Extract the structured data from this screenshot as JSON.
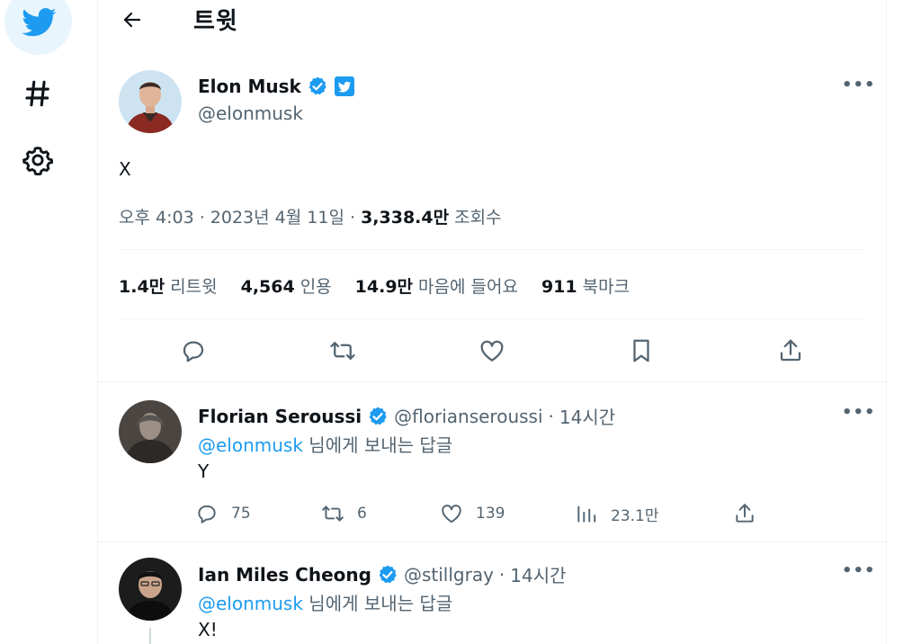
{
  "nav": {
    "logo_icon": "twitter-bird-icon",
    "items": [
      {
        "icon": "hashtag-icon"
      },
      {
        "icon": "gear-icon"
      }
    ]
  },
  "header": {
    "back_icon": "arrow-left-icon",
    "title": "트윗"
  },
  "tweet": {
    "author_name": "Elon Musk",
    "author_handle": "@elonmusk",
    "text": "X",
    "time": "오후 4:03",
    "date": "2023년 4월 11일",
    "views": "3,338.4만",
    "views_label": "조회수",
    "sep": " · ",
    "stats": [
      {
        "value": "1.4만",
        "label": "리트윗"
      },
      {
        "value": "4,564",
        "label": "인용"
      },
      {
        "value": "14.9만",
        "label": "마음에 들어요"
      },
      {
        "value": "911",
        "label": "북마크"
      }
    ],
    "more": "•••"
  },
  "replies": [
    {
      "name": "Florian Seroussi",
      "handle": "@florianseroussi",
      "time": "14시간",
      "mention": "@elonmusk",
      "reply_suffix": " 님에게 보내는 답글",
      "text": "Y",
      "replies": "75",
      "retweets": "6",
      "likes": "139",
      "views": "23.1만",
      "more": "•••"
    },
    {
      "name": "Ian Miles Cheong",
      "handle": "@stillgray",
      "time": "14시간",
      "mention": "@elonmusk",
      "reply_suffix": " 님에게 보내는 답글",
      "text": "X!",
      "more": "•••"
    }
  ],
  "colors": {
    "accent": "#1d9bf0",
    "text": "#0f1419",
    "secondary": "#536471",
    "border": "#eff3f4"
  }
}
